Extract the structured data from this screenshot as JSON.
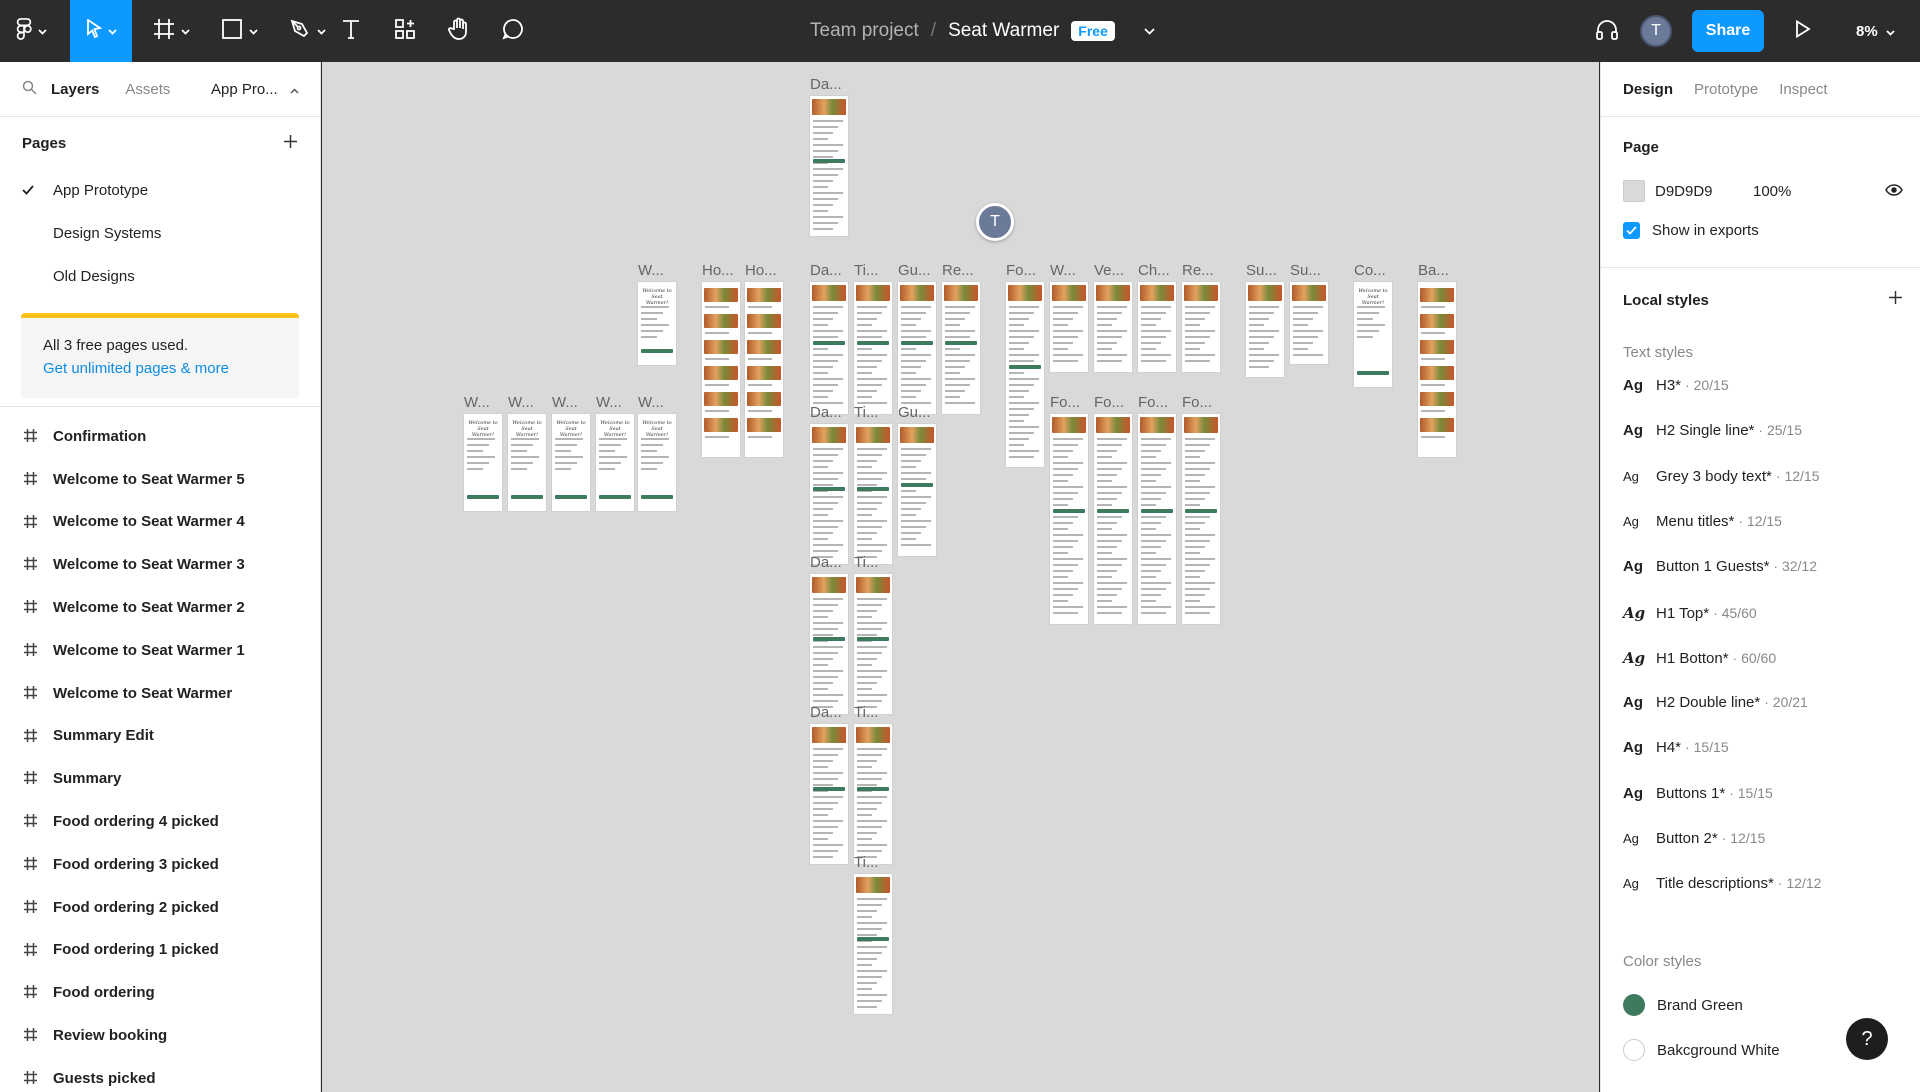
{
  "toolbar": {
    "project": "Team project",
    "separator": "/",
    "file_name": "Seat Warmer",
    "plan_badge": "Free",
    "user_initial": "T",
    "share_label": "Share",
    "zoom": "8%"
  },
  "left_panel": {
    "tabs": [
      "Layers",
      "Assets"
    ],
    "page_selector": "App Pro...",
    "pages_title": "Pages",
    "pages": [
      "App Prototype",
      "Design Systems",
      "Old Designs"
    ],
    "upsell_text": "All 3 free pages used.",
    "upsell_link": "Get unlimited pages & more",
    "frames": [
      "Confirmation",
      "Welcome to Seat Warmer 5",
      "Welcome to Seat Warmer 4",
      "Welcome to Seat Warmer 3",
      "Welcome to Seat Warmer 2",
      "Welcome to Seat Warmer 1",
      "Welcome to Seat Warmer",
      "Summary Edit",
      "Summary",
      "Food ordering 4 picked",
      "Food ordering 3 picked",
      "Food ordering 2 picked",
      "Food ordering 1 picked",
      "Food ordering",
      "Review booking",
      "Guests picked"
    ]
  },
  "canvas": {
    "frame_labels": [
      "Da...",
      "W...",
      "Ho...",
      "Ho...",
      "Da...",
      "Ti...",
      "Gu...",
      "Re...",
      "Fo...",
      "W...",
      "Ve...",
      "Ch...",
      "Re...",
      "Su...",
      "Su...",
      "Co...",
      "Ba...",
      "W...",
      "W...",
      "W...",
      "W...",
      "W...",
      "Da...",
      "Ti...",
      "Gu...",
      "Fo...",
      "Fo...",
      "Fo...",
      "Fo...",
      "Da...",
      "Ti...",
      "Da...",
      "Ti...",
      "Ti..."
    ],
    "thumb_title_lines": [
      "Welcome to",
      "Seat Warmer!"
    ],
    "collaborator_initial": "T"
  },
  "right_panel": {
    "tabs": [
      "Design",
      "Prototype",
      "Inspect"
    ],
    "page_title": "Page",
    "page_color": "D9D9D9",
    "page_opacity": "100%",
    "show_in_exports": "Show in exports",
    "local_styles": "Local styles",
    "text_styles_title": "Text styles",
    "text_styles": [
      {
        "name": "H3*",
        "meta": "· 20/15"
      },
      {
        "name": "H2 Single line*",
        "meta": "· 25/15"
      },
      {
        "name": "Grey 3 body text*",
        "meta": "· 12/15"
      },
      {
        "name": "Menu titles*",
        "meta": "· 12/15"
      },
      {
        "name": "Button 1 Guests*",
        "meta": "· 32/12"
      },
      {
        "name": "H1 Top*",
        "meta": "· 45/60"
      },
      {
        "name": "H1 Botton*",
        "meta": "· 60/60"
      },
      {
        "name": "H2 Double line*",
        "meta": "· 20/21"
      },
      {
        "name": "H4*",
        "meta": "· 15/15"
      },
      {
        "name": "Buttons 1*",
        "meta": "· 15/15"
      },
      {
        "name": "Button 2*",
        "meta": "· 12/15"
      },
      {
        "name": "Title descriptions*",
        "meta": "· 12/12"
      }
    ],
    "text_style_glyph": "Ag",
    "color_styles_title": "Color styles",
    "color_styles": [
      {
        "name": "Brand Green",
        "color": "#3e7a5d"
      },
      {
        "name": "Bakcground White",
        "color": "#ffffff"
      }
    ],
    "help": "?"
  },
  "colors": {
    "accent": "#0d99ff",
    "canvas": "#d9d9d9",
    "toolbar": "#2c2c2c",
    "upsell_bar": "#ffc21a"
  }
}
